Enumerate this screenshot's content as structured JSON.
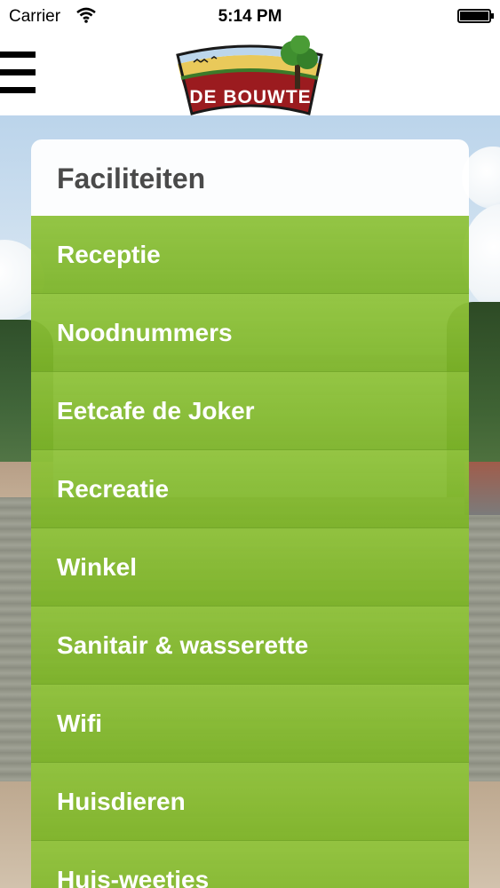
{
  "status_bar": {
    "carrier": "Carrier",
    "time": "5:14 PM",
    "wifi_icon": "wifi-icon",
    "battery_icon": "battery-icon"
  },
  "header": {
    "menu_icon": "hamburger-menu-icon",
    "logo_text": "DE BOUWTE"
  },
  "panel": {
    "title": "Faciliteiten",
    "items": [
      {
        "label": "Receptie"
      },
      {
        "label": "Noodnummers"
      },
      {
        "label": "Eetcafe de Joker"
      },
      {
        "label": "Recreatie"
      },
      {
        "label": "Winkel"
      },
      {
        "label": "Sanitair & wasserette"
      },
      {
        "label": "Wifi"
      },
      {
        "label": "Huisdieren"
      },
      {
        "label": "Huis-weeties"
      }
    ]
  },
  "colors": {
    "menu_green": "#87bd32",
    "header_text": "#4a4a4a",
    "logo_red": "#9b1b1f"
  }
}
